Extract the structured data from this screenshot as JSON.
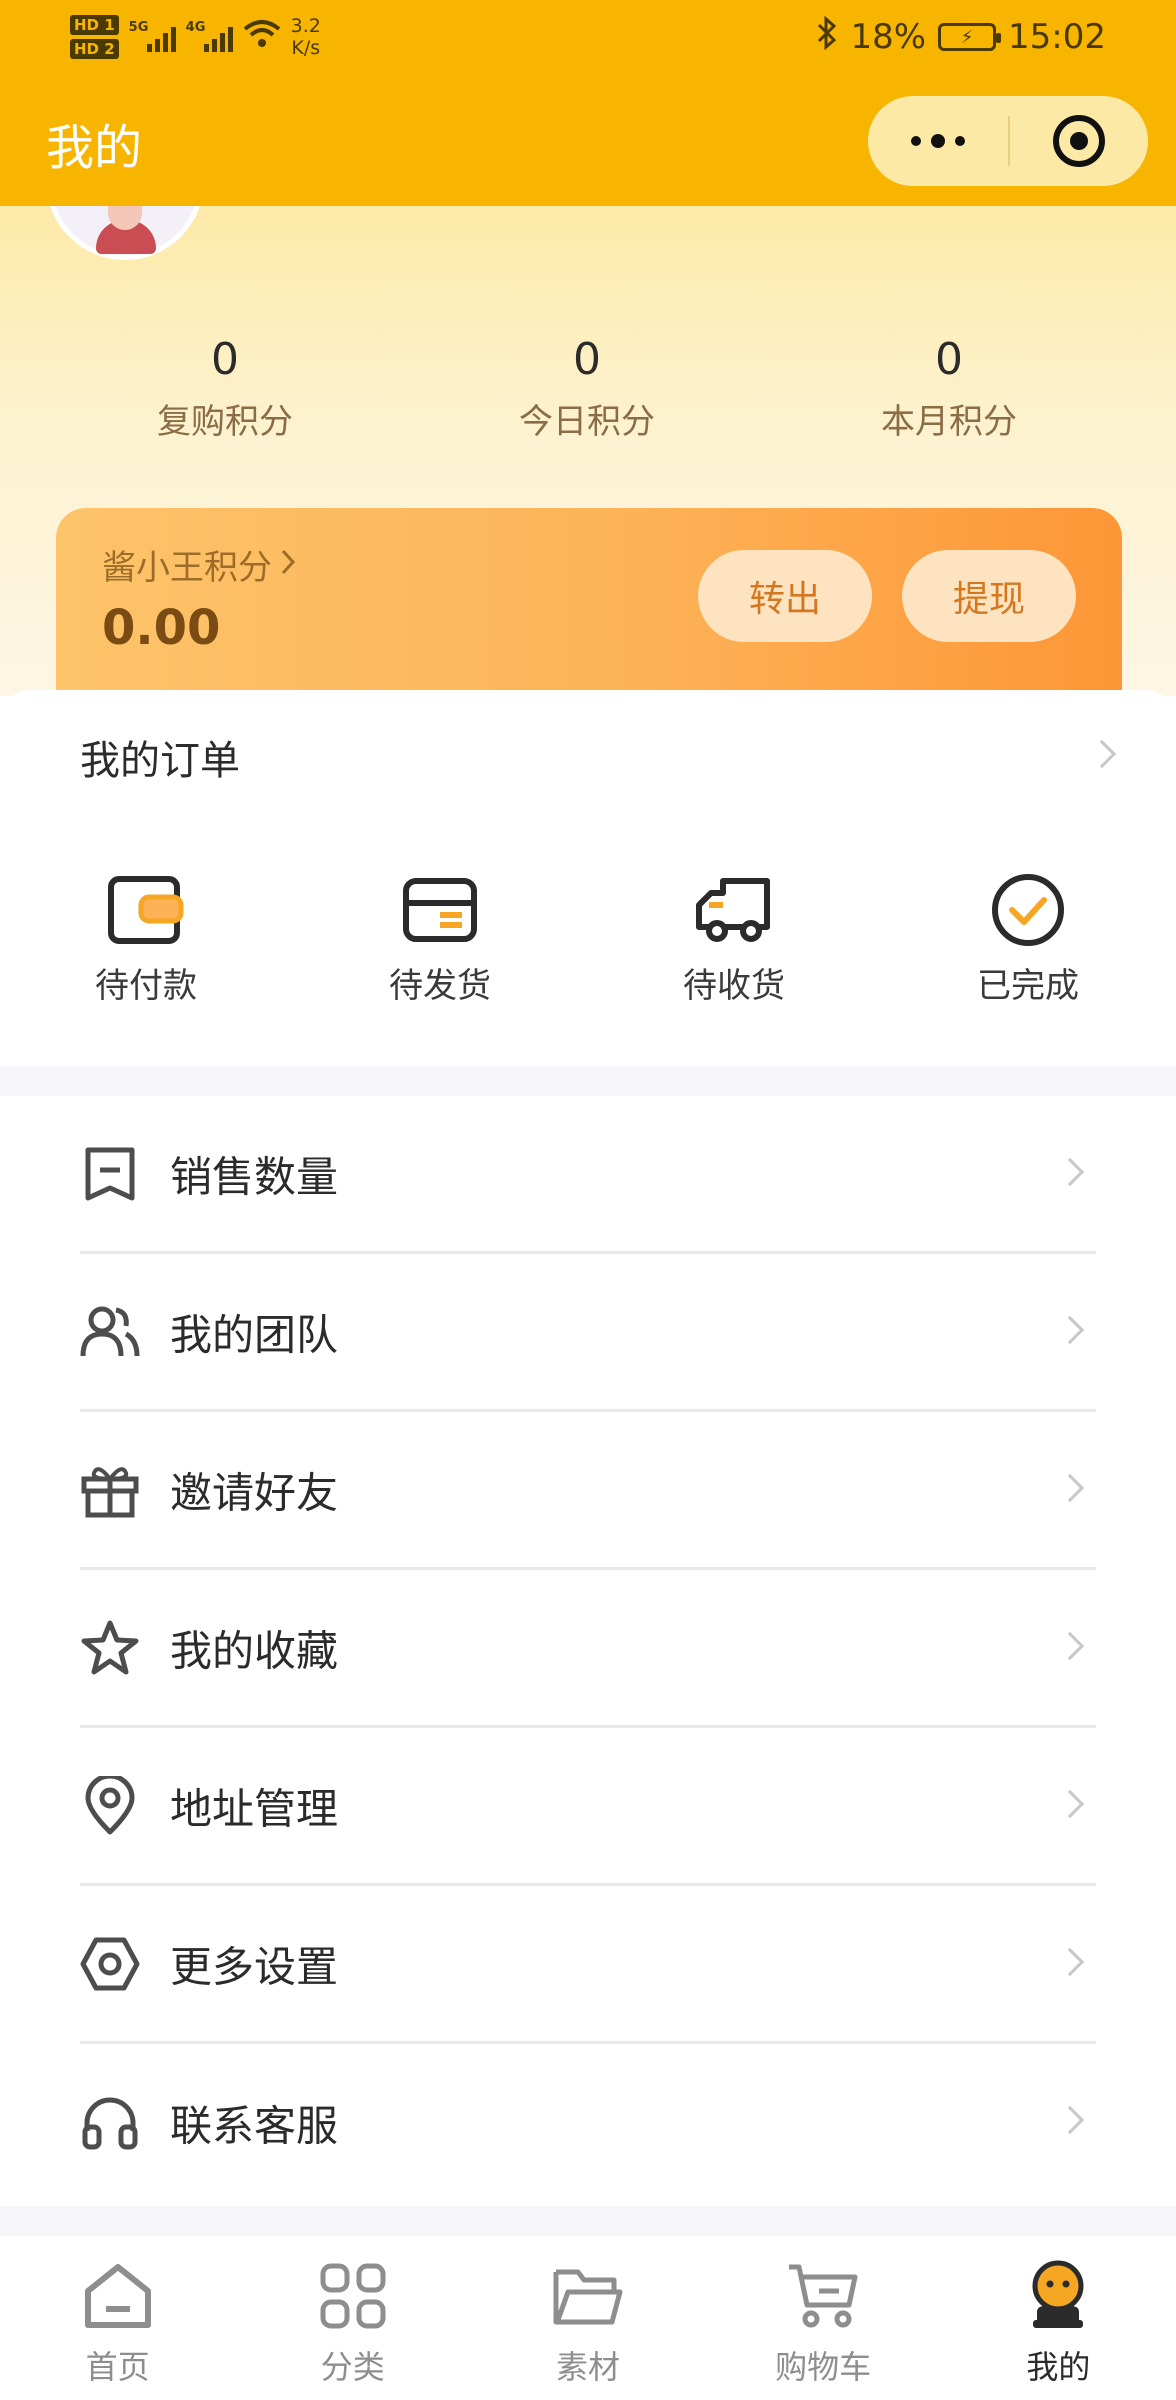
{
  "status_bar": {
    "hd1": "HD 1",
    "hd2": "HD 2",
    "net1": "5G",
    "net2": "4G",
    "speed_value": "3.2",
    "speed_unit": "K/s",
    "battery_percent": "18%",
    "time": "15:02"
  },
  "title_bar": {
    "title": "我的"
  },
  "stats": [
    {
      "value": "0",
      "label": "复购积分"
    },
    {
      "value": "0",
      "label": "今日积分"
    },
    {
      "value": "0",
      "label": "本月积分"
    }
  ],
  "points_card": {
    "label": "酱小王积分",
    "amount": "0.00",
    "transfer_button": "转出",
    "withdraw_button": "提现"
  },
  "orders": {
    "title": "我的订单",
    "items": [
      {
        "label": "待付款",
        "icon": "wallet-icon"
      },
      {
        "label": "待发货",
        "icon": "card-icon"
      },
      {
        "label": "待收货",
        "icon": "truck-icon"
      },
      {
        "label": "已完成",
        "icon": "check-circle-icon"
      }
    ]
  },
  "menu": [
    {
      "label": "销售数量",
      "icon": "bookmark-icon"
    },
    {
      "label": "我的团队",
      "icon": "users-icon"
    },
    {
      "label": "邀请好友",
      "icon": "gift-icon"
    },
    {
      "label": "我的收藏",
      "icon": "star-icon"
    },
    {
      "label": "地址管理",
      "icon": "location-pin-icon"
    },
    {
      "label": "更多设置",
      "icon": "settings-hexagon-icon"
    },
    {
      "label": "联系客服",
      "icon": "headphones-icon"
    }
  ],
  "tabbar": [
    {
      "label": "首页",
      "icon": "home-icon",
      "active": false
    },
    {
      "label": "分类",
      "icon": "grid-icon",
      "active": false
    },
    {
      "label": "素材",
      "icon": "folder-icon",
      "active": false
    },
    {
      "label": "购物车",
      "icon": "cart-icon",
      "active": false
    },
    {
      "label": "我的",
      "icon": "profile-icon",
      "active": true
    }
  ],
  "colors": {
    "brand_yellow": "#f7b500",
    "accent_orange": "#fd9636",
    "label_brown": "#8b6d45",
    "icon_orange": "#f5a623"
  }
}
